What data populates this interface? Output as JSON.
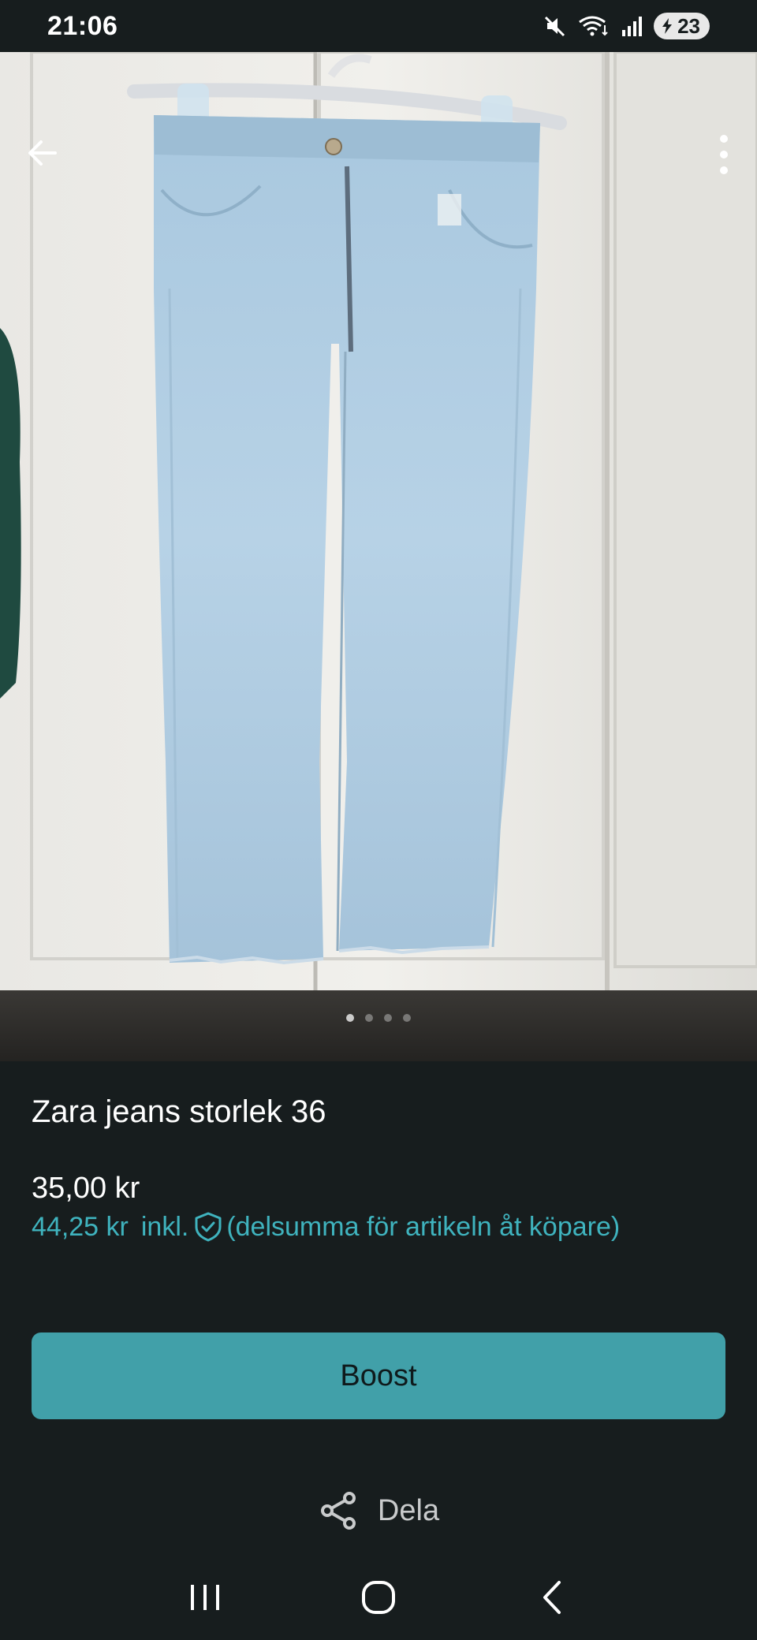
{
  "status_bar": {
    "time": "21:06",
    "battery": "23",
    "icons": [
      "mute-icon",
      "wifi-icon",
      "signal-icon",
      "battery-icon"
    ]
  },
  "product": {
    "title": "Zara jeans storlek 36",
    "price": "35,00 kr",
    "price_incl_amount": "44,25 kr",
    "price_incl_label": "inkl.",
    "price_incl_note": "(delsumma för artikeln åt köpare)"
  },
  "actions": {
    "boost_label": "Boost",
    "share_label": "Dela"
  },
  "gallery": {
    "photo_count": 4,
    "active_index": 0
  },
  "colors": {
    "background": "#171d1e",
    "accent": "#41a0a9",
    "accent_text": "#3fb3be"
  }
}
